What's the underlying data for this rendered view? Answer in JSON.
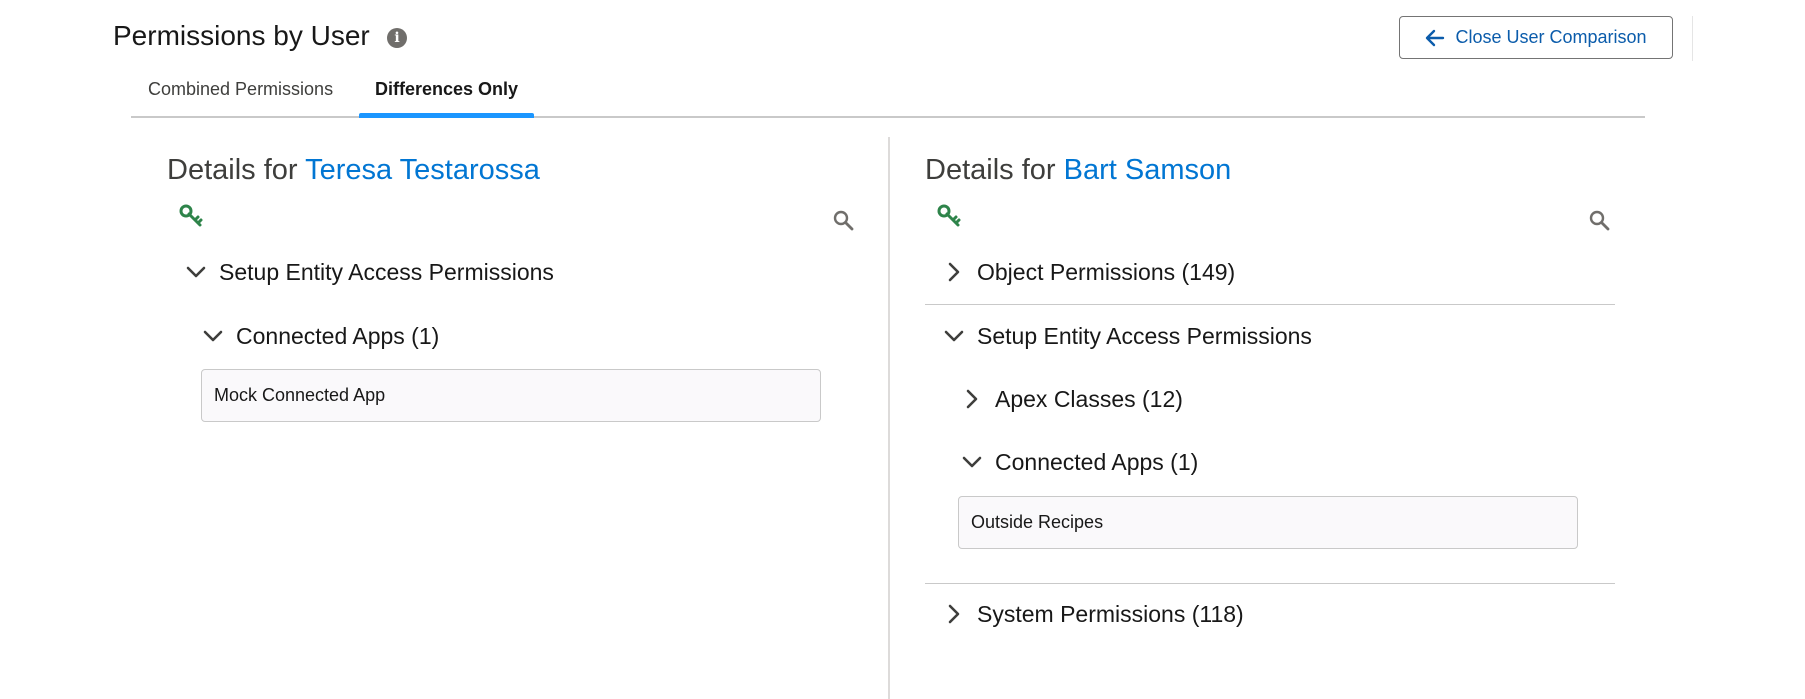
{
  "header": {
    "title": "Permissions by User",
    "close_button_label": "Close User Comparison"
  },
  "tabs": [
    {
      "label": "Combined Permissions",
      "active": false
    },
    {
      "label": "Differences Only",
      "active": true
    }
  ],
  "left_panel": {
    "details_prefix": "Details for",
    "user_name": "Teresa Testarossa",
    "tree": {
      "section_label": "Setup Entity Access Permissions",
      "subsection_label": "Connected Apps (1)",
      "items": [
        "Mock Connected App"
      ]
    }
  },
  "right_panel": {
    "details_prefix": "Details for",
    "user_name": "Bart Samson",
    "tree": {
      "object_permissions_label": "Object Permissions (149)",
      "section_label": "Setup Entity Access Permissions",
      "apex_classes_label": "Apex Classes (12)",
      "connected_apps_label": "Connected Apps (1)",
      "items": [
        "Outside Recipes"
      ],
      "system_permissions_label": "System Permissions (118)"
    }
  },
  "colors": {
    "accent": "#0176d3",
    "tab_active_bar": "#1b96ff",
    "key_icon": "#2e844a",
    "icon_gray": "#706e6b"
  },
  "icons": {
    "info": "info-icon",
    "back": "arrow-left-icon",
    "key": "key-icon",
    "search": "search-icon",
    "expand": "chevron-right-icon",
    "collapse": "chevron-down-icon"
  }
}
